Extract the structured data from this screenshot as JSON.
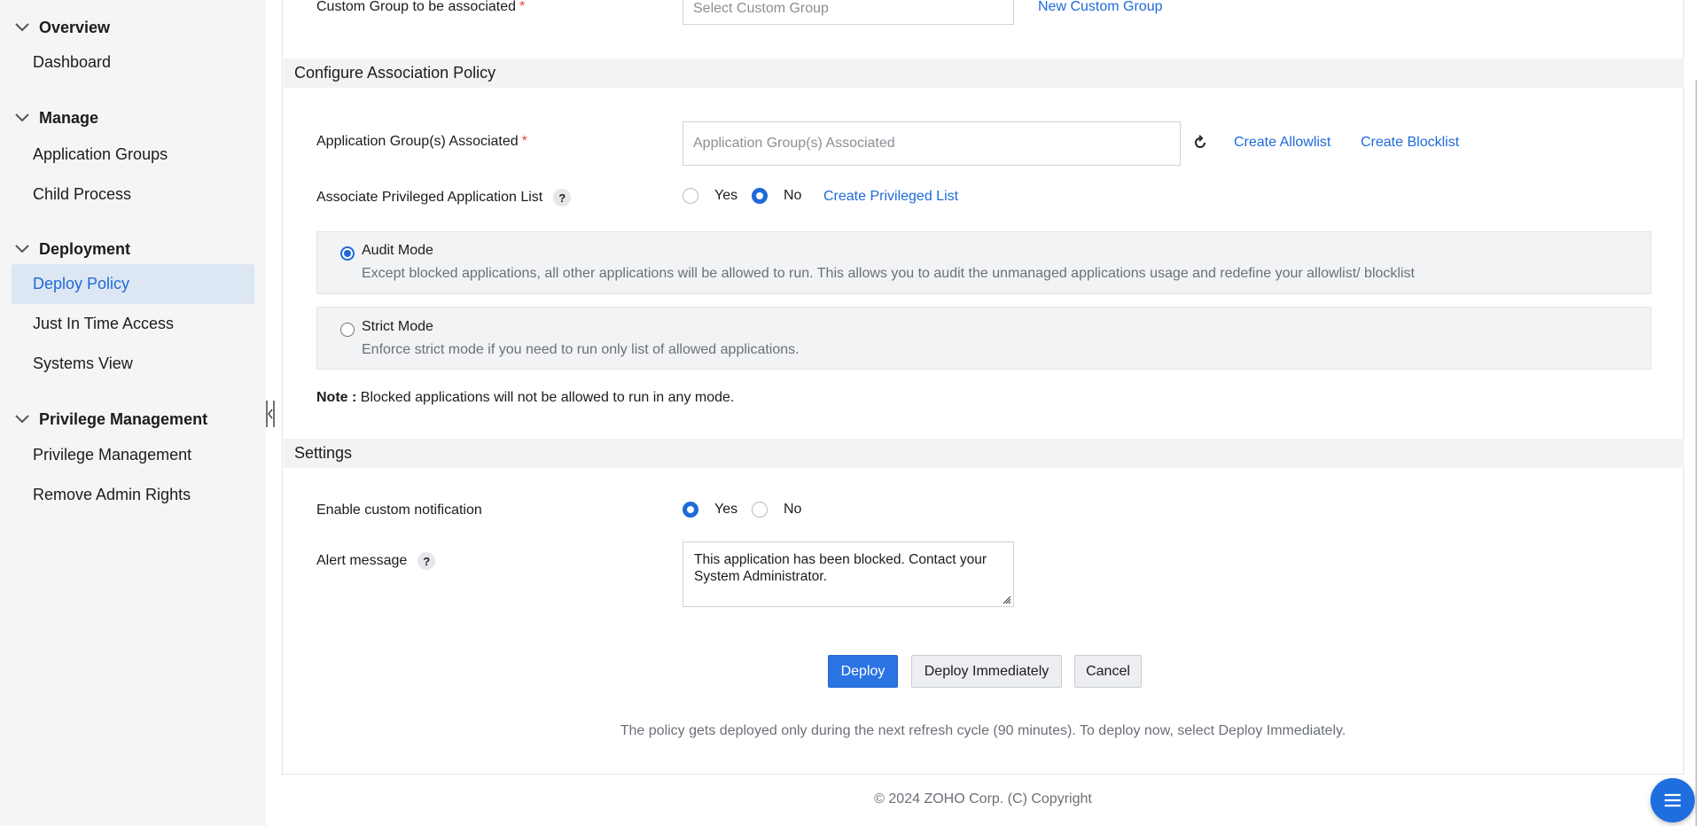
{
  "sidebar": {
    "groups": [
      {
        "title": "Overview",
        "items": [
          {
            "label": "Dashboard"
          }
        ]
      },
      {
        "title": "Manage",
        "items": [
          {
            "label": "Application Groups"
          },
          {
            "label": "Child Process"
          }
        ]
      },
      {
        "title": "Deployment",
        "items": [
          {
            "label": "Deploy Policy"
          },
          {
            "label": "Just In Time Access"
          },
          {
            "label": "Systems View"
          }
        ]
      },
      {
        "title": "Privilege Management",
        "items": [
          {
            "label": "Privilege Management"
          },
          {
            "label": "Remove Admin Rights"
          }
        ]
      }
    ],
    "active_item": "Deploy Policy"
  },
  "custom_group": {
    "label": "Custom Group to be associated",
    "required_mark": "*",
    "placeholder": "Select Custom Group",
    "new_link": "New Custom Group"
  },
  "association": {
    "section_title": "Configure Association Policy",
    "app_groups_label": "Application Group(s) Associated",
    "required_mark": "*",
    "app_groups_placeholder": "Application Group(s) Associated",
    "create_allowlist": "Create Allowlist",
    "create_blocklist": "Create Blocklist",
    "privileged_label": "Associate Privileged Application List",
    "help": "?",
    "yes": "Yes",
    "no": "No",
    "privileged_selected": "No",
    "create_privileged_list": "Create Privileged List",
    "audit_mode_title": "Audit Mode",
    "audit_mode_desc": "Except blocked applications, all other applications will be allowed to run. This allows you to audit the unmanaged applications usage and redefine your allowlist/ blocklist",
    "strict_mode_title": "Strict Mode",
    "strict_mode_desc": "Enforce strict mode if you need to run only list of allowed applications.",
    "selected_mode": "Audit Mode",
    "note_label": "Note :",
    "note_text": "Blocked applications will not be allowed to run in any mode."
  },
  "settings": {
    "section_title": "Settings",
    "notification_label": "Enable custom notification",
    "yes": "Yes",
    "no": "No",
    "notification_selected": "Yes",
    "alert_label": "Alert message",
    "help": "?",
    "alert_message": "This application has been blocked. Contact your System Administrator."
  },
  "actions": {
    "deploy": "Deploy",
    "deploy_immediately": "Deploy Immediately",
    "cancel": "Cancel",
    "hint": "The policy gets deployed only during the next refresh cycle (90 minutes). To deploy now, select Deploy Immediately."
  },
  "footer": {
    "copyright": "© 2024 ZOHO Corp. (C) Copyright"
  },
  "icons": {
    "chevron": "chevron-down-icon",
    "refresh": "refresh-icon",
    "menu": "menu-icon",
    "collapse": "sidebar-collapse-icon",
    "resize": "resize-grip-icon"
  },
  "colors": {
    "accent": "#2b74e4",
    "link": "#1e6ad8",
    "required": "#e04a3b",
    "active_nav_bg": "#dde7f3"
  }
}
